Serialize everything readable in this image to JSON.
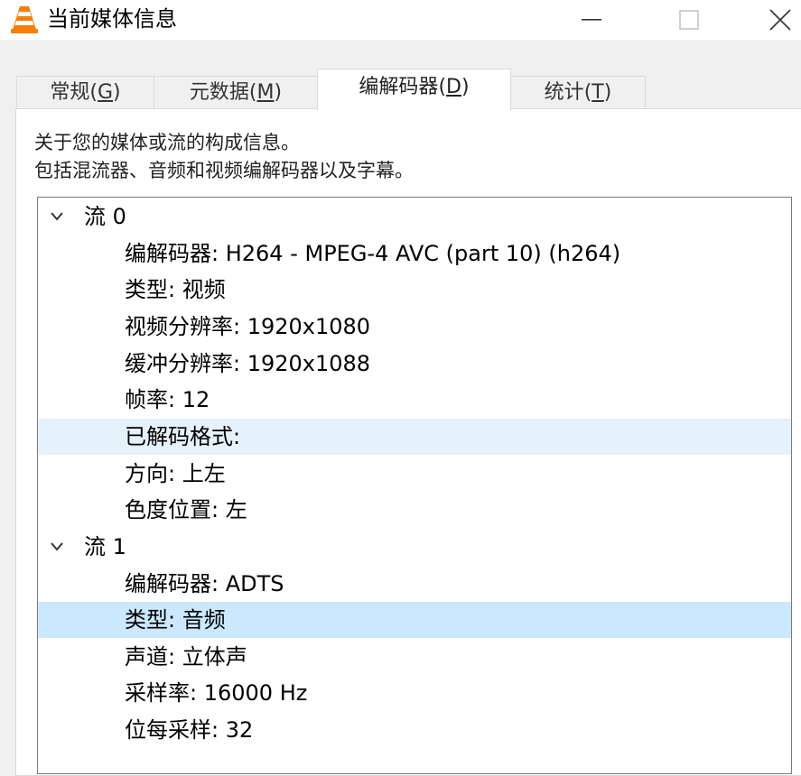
{
  "window": {
    "title": "当前媒体信息",
    "controls": {
      "minimize": "—",
      "maximize": "☐",
      "close": "✕"
    }
  },
  "tabs": [
    {
      "label": "常规",
      "mnemonic": "G",
      "active": false
    },
    {
      "label": "元数据",
      "mnemonic": "M",
      "active": false
    },
    {
      "label": "编解码器",
      "mnemonic": "D",
      "active": true
    },
    {
      "label": "统计",
      "mnemonic": "T",
      "active": false
    }
  ],
  "description": {
    "line1": "关于您的媒体或流的构成信息。",
    "line2": "包括混流器、音频和视频编解码器以及字幕。"
  },
  "streams": [
    {
      "label": "流 0",
      "expanded": true,
      "items": [
        "编解码器: H264 - MPEG-4 AVC (part 10) (h264)",
        "类型: 视频",
        "视频分辨率: 1920x1080",
        "缓冲分辨率: 1920x1088",
        "帧率: 12",
        "已解码格式:",
        "方向: 上左",
        "色度位置: 左"
      ]
    },
    {
      "label": "流 1",
      "expanded": true,
      "items": [
        "编解码器: ADTS",
        "类型: 音频",
        "声道: 立体声",
        "采样率: 16000 Hz",
        "位每采样: 32"
      ]
    }
  ],
  "highlight": {
    "hover_row": "已解码格式:",
    "selected_row": "类型: 音频",
    "hover_color": "#e5f1fb",
    "selected_color": "#cce8ff"
  },
  "colors": {
    "titlebar": "#ffffff",
    "window_bg": "#f0f0f0",
    "cone_orange": "#f57f00"
  }
}
